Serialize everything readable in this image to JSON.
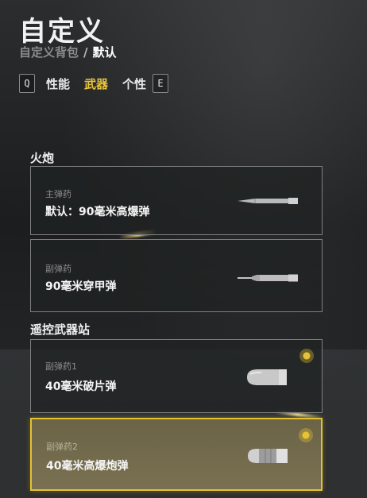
{
  "header": {
    "title": "自定义",
    "breadcrumb_parent": "自定义背包",
    "breadcrumb_separator": "/",
    "breadcrumb_current": "默认"
  },
  "tabs": {
    "key_left": "Q",
    "items": [
      "性能",
      "武器",
      "个性"
    ],
    "active": "武器",
    "key_right": "E"
  },
  "sections": [
    {
      "title": "火炮",
      "cards": [
        {
          "label": "主弹药",
          "value": "默认：90毫米高爆弹",
          "icon": "he-shell-icon"
        },
        {
          "label": "副弹药",
          "value": "90毫米穿甲弹",
          "icon": "ap-shell-icon"
        }
      ]
    },
    {
      "title": "遥控武器站",
      "cards": [
        {
          "label": "副弹药1",
          "value": "40毫米破片弹",
          "icon": "grenade-round-icon",
          "equipped": true
        },
        {
          "label": "副弹药2",
          "value": "40毫米高爆炮弹",
          "icon": "grenade-he-round-icon",
          "equipped": true,
          "selected": true
        }
      ]
    }
  ],
  "colors": {
    "accent": "#e3c232",
    "text": "#ffffff",
    "muted": "#8e8e8e",
    "card_border": "#7d7f80"
  }
}
